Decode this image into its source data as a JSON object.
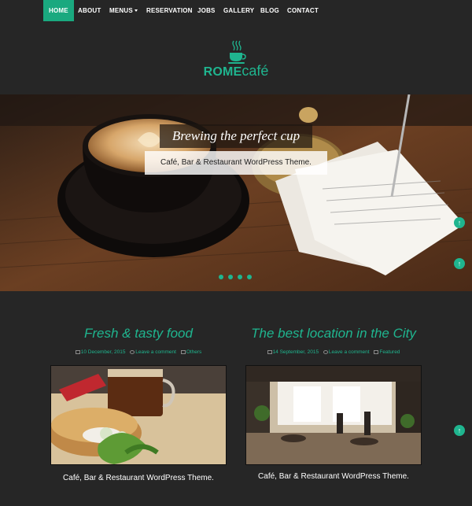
{
  "nav": {
    "items": [
      {
        "label": "HOME",
        "active": true
      },
      {
        "label": "ABOUT"
      },
      {
        "label": "MENUS"
      },
      {
        "label": "RESERVATION"
      },
      {
        "label": "JOBS"
      },
      {
        "label": "GALLERY"
      },
      {
        "label": "BLOG"
      },
      {
        "label": "CONTACT"
      }
    ]
  },
  "logo": {
    "rome": "ROME",
    "cafe": "café",
    "icon": "coffee-cup-icon"
  },
  "hero": {
    "title": "Brewing the perfect cup",
    "subtitle": "Café, Bar & Restaurant WordPress Theme.",
    "slide_count": 4,
    "active_slide": 0
  },
  "posts": [
    {
      "title": "Fresh & tasty food",
      "date": "10 December, 2015",
      "comment": "Leave a comment",
      "category": "Others",
      "excerpt": "Café, Bar & Restaurant WordPress Theme."
    },
    {
      "title": "The best location in the City",
      "date": "14 September, 2015",
      "comment": "Leave a comment",
      "category": "Featured",
      "excerpt": "Café, Bar & Restaurant WordPress Theme."
    }
  ],
  "colors": {
    "accent": "#1fb58f",
    "background": "#262626",
    "nav_active": "#1aa97f"
  }
}
